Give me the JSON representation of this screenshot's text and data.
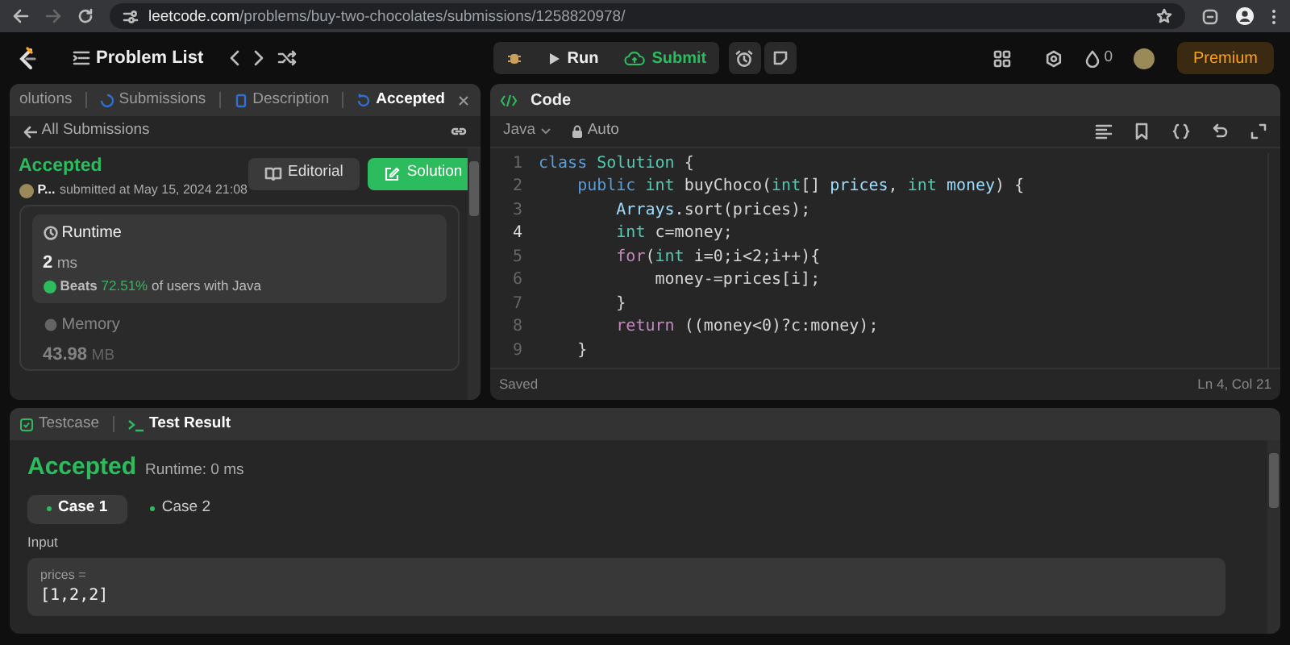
{
  "browser": {
    "url_host": "leetcode.com",
    "url_path": "/problems/buy-two-chocolates/submissions/1258820978/"
  },
  "nav": {
    "title": "Problem List",
    "run": "Run",
    "submit": "Submit",
    "streak": "0",
    "premium": "Premium"
  },
  "left_tabs": [
    {
      "label": "olutions",
      "selected": false
    },
    {
      "label": "Submissions",
      "selected": false
    },
    {
      "label": "Description",
      "selected": false
    },
    {
      "label": "Accepted",
      "selected": true
    }
  ],
  "back_link": "All Submissions",
  "submission": {
    "status": "Accepted",
    "user": "P...",
    "submitted": "submitted at May 15, 2024 21:08",
    "editorial": "Editorial",
    "solution": "Solution"
  },
  "runtime": {
    "title": "Runtime",
    "value": "2",
    "unit": "ms",
    "beats": "Beats",
    "percent": "72.51%",
    "suffix": "of users with Java"
  },
  "memory": {
    "title": "Memory",
    "value": "43.98",
    "unit": "MB"
  },
  "editor": {
    "title": "Code",
    "language": "Java",
    "mode": "Auto",
    "status": "Saved",
    "cursor": "Ln 4, Col 21",
    "lines": [
      {
        "number": "1",
        "current": false,
        "tokens": [
          {
            "kind": "keyword",
            "text": "class"
          },
          {
            "kind": "type",
            "text": " Solution"
          },
          {
            "kind": "plain",
            "text": " {"
          }
        ]
      },
      {
        "number": "2",
        "current": false,
        "tokens": [
          {
            "kind": "keyword",
            "text": "    public"
          },
          {
            "kind": "type",
            "text": " int"
          },
          {
            "kind": "plain",
            "text": " buyChoco("
          },
          {
            "kind": "type",
            "text": "int"
          },
          {
            "kind": "plain",
            "text": "[]"
          },
          {
            "kind": "variable",
            "text": " prices"
          },
          {
            "kind": "plain",
            "text": ","
          },
          {
            "kind": "type",
            "text": " int"
          },
          {
            "kind": "variable",
            "text": " money"
          },
          {
            "kind": "plain",
            "text": ") {"
          }
        ]
      },
      {
        "number": "3",
        "current": false,
        "tokens": [
          {
            "kind": "variable",
            "text": "        Arrays"
          },
          {
            "kind": "plain",
            "text": ".sort(prices);"
          }
        ]
      },
      {
        "number": "4",
        "current": true,
        "tokens": [
          {
            "kind": "type",
            "text": "        int"
          },
          {
            "kind": "plain",
            "text": " c=money;"
          }
        ]
      },
      {
        "number": "5",
        "current": false,
        "tokens": [
          {
            "kind": "control",
            "text": "        for"
          },
          {
            "kind": "plain",
            "text": "("
          },
          {
            "kind": "type",
            "text": "int"
          },
          {
            "kind": "plain",
            "text": " i=0;i<2;i++){"
          }
        ]
      },
      {
        "number": "6",
        "current": false,
        "tokens": [
          {
            "kind": "plain",
            "text": "            money-=prices[i];"
          }
        ]
      },
      {
        "number": "7",
        "current": false,
        "tokens": [
          {
            "kind": "plain",
            "text": "        }"
          }
        ]
      },
      {
        "number": "8",
        "current": false,
        "tokens": [
          {
            "kind": "control",
            "text": "        return"
          },
          {
            "kind": "plain",
            "text": " ((money<0)?c:money);"
          }
        ]
      },
      {
        "number": "9",
        "current": false,
        "tokens": [
          {
            "kind": "plain",
            "text": "    }"
          }
        ]
      }
    ]
  },
  "test_tabs": [
    {
      "label": "Testcase",
      "selected": false
    },
    {
      "label": "Test Result",
      "selected": true
    }
  ],
  "result": {
    "status": "Accepted",
    "runtime": "Runtime: 0 ms",
    "input_label": "Input",
    "param_name": "prices =",
    "param_value": "[1,2,2]"
  },
  "cases": [
    {
      "label": "Case 1",
      "selected": true
    },
    {
      "label": "Case 2",
      "selected": false
    }
  ]
}
